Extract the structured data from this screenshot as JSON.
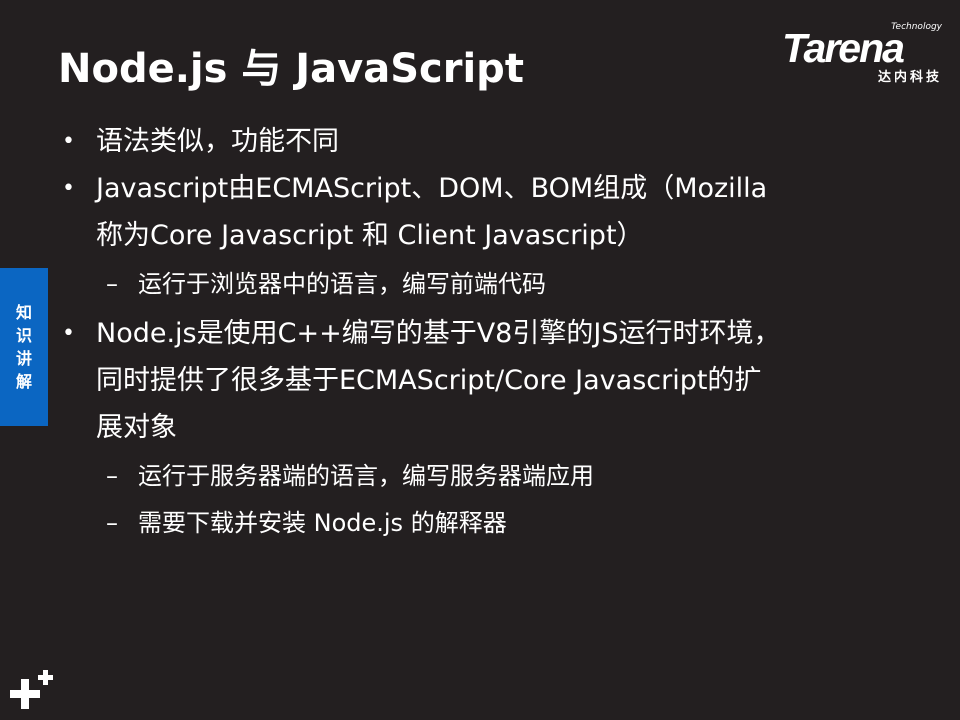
{
  "title": "Node.js 与 JavaScript",
  "logo": {
    "small": "Technology",
    "main": "Tarena",
    "sub": "达内科技"
  },
  "side_tab": {
    "chars": [
      "知",
      "识",
      "讲",
      "解"
    ]
  },
  "bullets": [
    {
      "text": "语法类似，功能不同",
      "subs": []
    },
    {
      "text": "Javascript由ECMAScript、DOM、BOM组成（Mozilla称为Core Javascript 和 Client Javascript）",
      "line1": "Javascript由ECMAScript、DOM、BOM组成（Mozilla",
      "line2": "称为Core Javascript 和 Client Javascript）",
      "subs": [
        "运行于浏览器中的语言，编写前端代码"
      ]
    },
    {
      "line1": "Node.js是使用C++编写的基于V8引擎的JS运行时环境，",
      "line2": "同时提供了很多基于ECMAScript/Core Javascript的扩",
      "line3": "展对象",
      "subs": [
        "运行于服务器端的语言，编写服务器端应用",
        "需要下载并安装 Node.js 的解释器"
      ]
    }
  ],
  "colors": {
    "background": "#231f20",
    "accent": "#0b66c2",
    "text": "#ffffff"
  }
}
